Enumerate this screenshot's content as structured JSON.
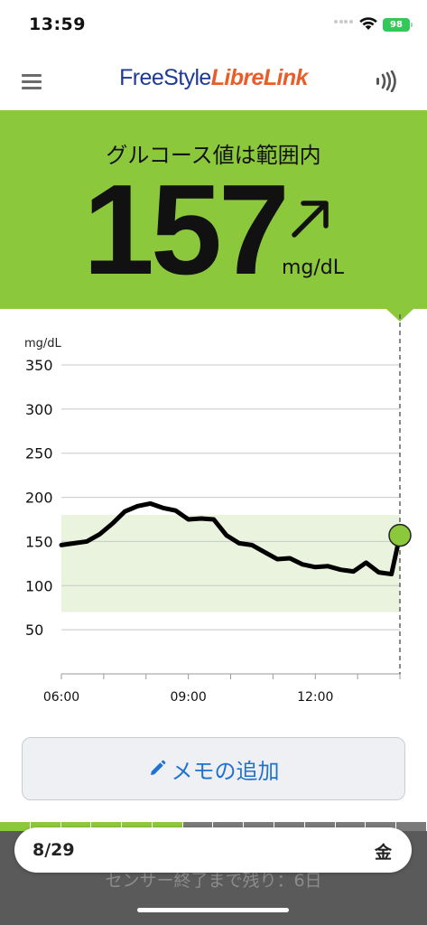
{
  "status_bar": {
    "time": "13:59",
    "battery": "98"
  },
  "header": {
    "brand_part1": "FreeStyle",
    "brand_part2": "LibreLink",
    "menu_icon": "hamburger-icon",
    "scan_icon": "nfc-scan-icon"
  },
  "glucose": {
    "status": "グルコース値は範囲内",
    "value": "157",
    "unit": "mg/dL",
    "trend": "rising-arrow-icon"
  },
  "chart_data": {
    "type": "line",
    "ylabel": "mg/dL",
    "y_ticks": [
      "350",
      "300",
      "250",
      "200",
      "150",
      "100",
      "50"
    ],
    "y_tick_values": [
      350,
      300,
      250,
      200,
      150,
      100,
      50
    ],
    "x_ticks": [
      "06:00",
      "09:00",
      "12:00"
    ],
    "x_tick_hours": [
      6,
      9,
      12
    ],
    "ylim": [
      0,
      350
    ],
    "xlim": [
      6,
      14
    ],
    "target_range": [
      70,
      180
    ],
    "grid": true,
    "series": [
      {
        "x": [
          6.0,
          6.3,
          6.6,
          6.9,
          7.2,
          7.5,
          7.8,
          8.1,
          8.4,
          8.7,
          9.0,
          9.3,
          9.6,
          9.9,
          10.2,
          10.5,
          10.8,
          11.1,
          11.4,
          11.7,
          12.0,
          12.3,
          12.6,
          12.9,
          13.2,
          13.5,
          13.8,
          14.0
        ],
        "y": [
          146,
          148,
          150,
          158,
          170,
          184,
          190,
          193,
          188,
          185,
          175,
          176,
          175,
          157,
          148,
          146,
          138,
          130,
          131,
          124,
          121,
          122,
          118,
          116,
          126,
          115,
          113,
          157
        ]
      }
    ],
    "current_point": {
      "x": 14.0,
      "y": 157
    },
    "colors": {
      "line": "#000000",
      "range_fill": "#e9f3dd",
      "current_point": "#8cc83c",
      "grid": "#c8c8c8"
    }
  },
  "actions": {
    "add_note": "メモの追加"
  },
  "bottom": {
    "date": "8/29",
    "day": "金",
    "sensor_remaining": "センサー終了まで残り：6日"
  },
  "colors": {
    "accent_green": "#8cc83c",
    "link_blue": "#1f72cf",
    "bottom_gray": "#5a5a5a"
  },
  "sensor_progress": {
    "segments_total": 14,
    "segments_elapsed": 6
  }
}
